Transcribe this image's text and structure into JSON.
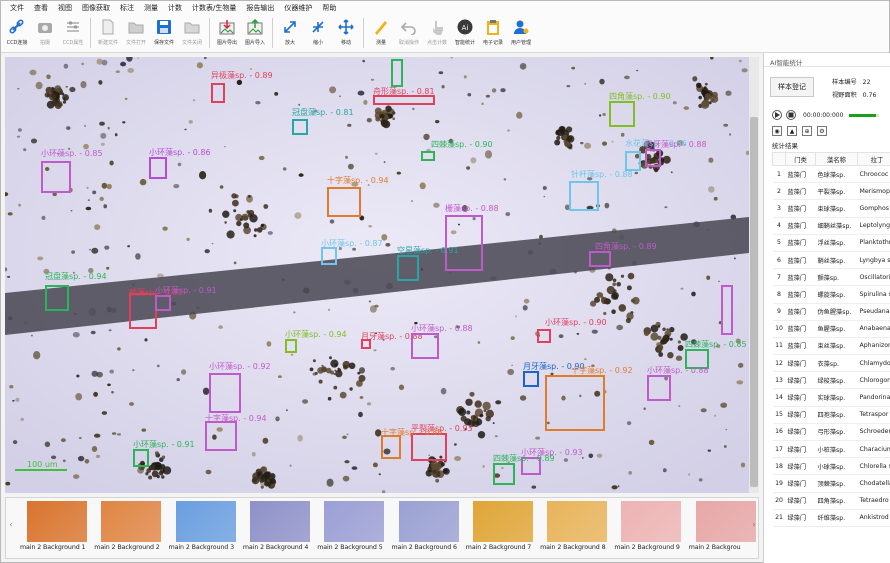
{
  "menu": [
    "文件",
    "查看",
    "视图",
    "图像获取",
    "标注",
    "测量",
    "计数",
    "计数表/生物量",
    "报告输出",
    "仪器维护",
    "帮助"
  ],
  "toolbar": [
    {
      "icon": "link-icon",
      "label": "CCD连接",
      "disabled": false
    },
    {
      "icon": "camera-icon",
      "label": "拍摄",
      "disabled": true
    },
    {
      "icon": "sliders-icon",
      "label": "CCD属性",
      "disabled": true
    },
    {
      "sep": true
    },
    {
      "icon": "new-file-icon",
      "label": "新建文件",
      "disabled": true
    },
    {
      "icon": "folder-open-icon",
      "label": "文件打开",
      "disabled": true
    },
    {
      "icon": "save-icon",
      "label": "保存文件",
      "disabled": false
    },
    {
      "icon": "folder-close-icon",
      "label": "文件关闭",
      "disabled": true
    },
    {
      "sep": true
    },
    {
      "icon": "image-export-icon",
      "label": "图片导出",
      "disabled": false
    },
    {
      "icon": "image-import-icon",
      "label": "图片导入",
      "disabled": false
    },
    {
      "sep": true
    },
    {
      "icon": "zoom-in-icon",
      "label": "放大",
      "disabled": false
    },
    {
      "icon": "zoom-out-icon",
      "label": "缩小",
      "disabled": false
    },
    {
      "icon": "move-icon",
      "label": "移动",
      "disabled": false
    },
    {
      "sep": true
    },
    {
      "icon": "ruler-icon",
      "label": "测量",
      "disabled": false
    },
    {
      "icon": "undo-icon",
      "label": "取消操作",
      "disabled": true
    },
    {
      "icon": "click-count-icon",
      "label": "点击计数",
      "disabled": true
    },
    {
      "icon": "ai-icon",
      "label": "智能统计",
      "disabled": false
    },
    {
      "icon": "clipboard-icon",
      "label": "电子记录",
      "disabled": false
    },
    {
      "icon": "user-manage-icon",
      "label": "用户管理",
      "disabled": false
    }
  ],
  "detections": [
    {
      "label": "异极藻sp. - 0.89",
      "color": "#e0405b"
    },
    {
      "label": "舟形藻sp. - 0.81",
      "color": "#e0405b"
    },
    {
      "label": "小环藻sp. - 0.8",
      "color": "#2db35a"
    },
    {
      "label": "冠盘藻sp. - 0.81",
      "color": "#2aa5a5"
    },
    {
      "label": "四角藻sp. - 0.90",
      "color": "#7fbf22"
    },
    {
      "label": "小环藻sp. - 0.85",
      "color": "#c05ac9"
    },
    {
      "label": "小环藻sp. - 0.86",
      "color": "#b24fd1"
    },
    {
      "label": "四棘藻sp. - 0.90",
      "color": "#2db35a"
    },
    {
      "label": "水花藻sp. - 0.86",
      "color": "#6ec7e8"
    },
    {
      "label": "月牙藻sp. - 0.88",
      "color": "#c05ac9"
    },
    {
      "label": "针杆藻sp. - 0.88",
      "color": "#6ec7e8"
    },
    {
      "label": "十字藻sp. - 0.94",
      "color": "#e07b2c"
    },
    {
      "label": "栅藻sp. - 0.88",
      "color": "#c05ac9"
    },
    {
      "label": "小环藻sp. - 0.87",
      "color": "#6ec7e8"
    },
    {
      "label": "空星藻sp. - 0.91",
      "color": "#2aa5a5"
    },
    {
      "label": "冠盘藻sp. - 0.94",
      "color": "#2db35a"
    },
    {
      "label": "鼓藻sp. - 0.81",
      "color": "#e0405b"
    },
    {
      "label": "小环藻sp. - 0.91",
      "color": "#c05ac9"
    },
    {
      "label": "四角藻sp. - 0.89",
      "color": "#c05ac9"
    },
    {
      "label": "小环藻sp. - 0.92",
      "color": "#c05ac9"
    },
    {
      "label": "小环藻sp. - 0.94",
      "color": "#7fbf22"
    },
    {
      "label": "月牙藻sp. - 0.88",
      "color": "#e0405b"
    },
    {
      "label": "小环藻sp. - 0.88",
      "color": "#c05ac9"
    },
    {
      "label": "小环藻sp. - 0.90",
      "color": "#e0405b"
    },
    {
      "label": "月牙藻sp. - 0.90",
      "color": "#1c63c9"
    },
    {
      "label": "十字藻sp. - 0.92",
      "color": "#e07b2c"
    },
    {
      "label": "四棘藻sp. - 0.85",
      "color": "#2db35a"
    },
    {
      "label": "小环藻sp. - 0.88",
      "color": "#c05ac9"
    },
    {
      "label": "小环藻sp. - 0.92",
      "color": "#c05ac9"
    },
    {
      "label": "十字藻sp. - 0.94",
      "color": "#c05ac9"
    },
    {
      "label": "平裂藻sp. - 0.93",
      "color": "#e0405b"
    },
    {
      "label": "十字藻sp. - 0.86",
      "color": "#e07b2c"
    },
    {
      "label": "小环藻sp. - 0.93",
      "color": "#c05ac9"
    },
    {
      "label": "四棘藻sp. - 0.89",
      "color": "#2db35a"
    },
    {
      "label": "小环藻sp. - 0.91",
      "color": "#2db35a"
    }
  ],
  "scale_bar": "100 um",
  "thumbnails": [
    {
      "label": "main 2 Background 1",
      "tint": "#d9742d"
    },
    {
      "label": "main 2 Background 2",
      "tint": "#e08544"
    },
    {
      "label": "main 2 Background 3",
      "tint": "#6a9ee0"
    },
    {
      "label": "main 2 Background 4",
      "tint": "#8e91c8"
    },
    {
      "label": "main 2 Background 5",
      "tint": "#9b9fd4"
    },
    {
      "label": "main 2 Background 6",
      "tint": "#9aa0d2"
    },
    {
      "label": "main 2 Background 7",
      "tint": "#e0a536"
    },
    {
      "label": "main 2 Background 8",
      "tint": "#e8b45a"
    },
    {
      "label": "main 2 Background 9",
      "tint": "#edb3b3"
    },
    {
      "label": "main 2 Backgrou",
      "tint": "#e7a7a7"
    }
  ],
  "panel": {
    "title": "AI智能统计",
    "register_button": "样本登记",
    "sample_no_label": "样本编号",
    "sample_no": "22",
    "field_area_label": "视野面积",
    "field_area": "0.76",
    "time": "00:00:00:000",
    "progress": 0.9,
    "stats_title": "统计结果",
    "columns": [
      "",
      "门类",
      "藻名称",
      "拉丁"
    ],
    "rows": [
      {
        "idx": "1",
        "phylum": "蓝藻门",
        "name": "色球藻sp.",
        "latin": "Chroococ"
      },
      {
        "idx": "2",
        "phylum": "蓝藻门",
        "name": "平裂藻sp.",
        "latin": "Merismop"
      },
      {
        "idx": "3",
        "phylum": "蓝藻门",
        "name": "束球藻sp.",
        "latin": "Gomphos"
      },
      {
        "idx": "4",
        "phylum": "蓝藻门",
        "name": "细鞘丝藻sp.",
        "latin": "Leptolyng"
      },
      {
        "idx": "5",
        "phylum": "蓝藻门",
        "name": "浮丝藻sp.",
        "latin": "Planktothr"
      },
      {
        "idx": "6",
        "phylum": "蓝藻门",
        "name": "鞘丝藻sp.",
        "latin": "Lyngbya s"
      },
      {
        "idx": "7",
        "phylum": "蓝藻门",
        "name": "颤藻sp.",
        "latin": "Oscillatori"
      },
      {
        "idx": "8",
        "phylum": "蓝藻门",
        "name": "螺旋藻sp.",
        "latin": "Spirulina s"
      },
      {
        "idx": "9",
        "phylum": "蓝藻门",
        "name": "伪鱼腥藻sp.",
        "latin": "Pseudanal"
      },
      {
        "idx": "10",
        "phylum": "蓝藻门",
        "name": "鱼腥藻sp.",
        "latin": "Anabaena"
      },
      {
        "idx": "11",
        "phylum": "蓝藻门",
        "name": "束丝藻sp.",
        "latin": "Aphanizon"
      },
      {
        "idx": "12",
        "phylum": "绿藻门",
        "name": "衣藻sp.",
        "latin": "Chlamydo"
      },
      {
        "idx": "13",
        "phylum": "绿藻门",
        "name": "绿梭藻sp.",
        "latin": "Chlorogon"
      },
      {
        "idx": "14",
        "phylum": "绿藻门",
        "name": "实球藻sp.",
        "latin": "Pandorina"
      },
      {
        "idx": "15",
        "phylum": "绿藻门",
        "name": "四孢藻sp.",
        "latin": "Tetraspor"
      },
      {
        "idx": "16",
        "phylum": "绿藻门",
        "name": "弓形藻sp.",
        "latin": "Schroeder"
      },
      {
        "idx": "17",
        "phylum": "绿藻门",
        "name": "小桩藻sp.",
        "latin": "Characium"
      },
      {
        "idx": "18",
        "phylum": "绿藻门",
        "name": "小球藻sp.",
        "latin": "Chlorella s"
      },
      {
        "idx": "19",
        "phylum": "绿藻门",
        "name": "顶棘藻sp.",
        "latin": "Chodatella"
      },
      {
        "idx": "20",
        "phylum": "绿藻门",
        "name": "四角藻sp.",
        "latin": "Tetraedro"
      },
      {
        "idx": "21",
        "phylum": "绿藻门",
        "name": "纤维藻sp.",
        "latin": "Ankistrod"
      }
    ]
  }
}
